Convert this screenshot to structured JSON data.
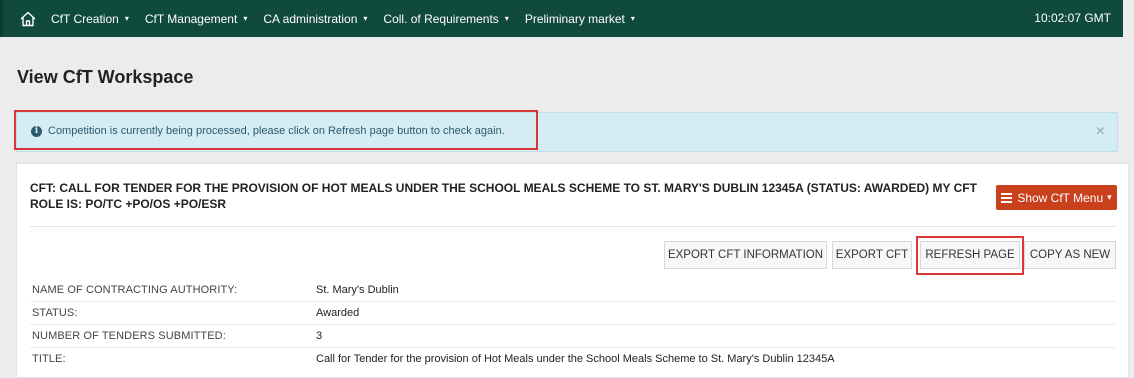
{
  "nav": {
    "items": [
      {
        "label": "CfT Creation"
      },
      {
        "label": "CfT Management"
      },
      {
        "label": "CA administration"
      },
      {
        "label": "Coll. of Requirements"
      },
      {
        "label": "Preliminary market"
      }
    ],
    "clock": "10:02:07 GMT",
    "home_icon": "home-icon"
  },
  "page": {
    "title": "View CfT Workspace"
  },
  "alert": {
    "text": "Competition is currently being processed, please click on Refresh page button to check again.",
    "close": "×",
    "info_icon": "i"
  },
  "cft": {
    "heading": "CFT: CALL FOR TENDER FOR THE PROVISION OF HOT MEALS UNDER THE SCHOOL MEALS SCHEME TO ST. MARY'S DUBLIN 12345A (STATUS: AWARDED) MY CFT ROLE IS: PO/TC +PO/OS +PO/ESR",
    "show_menu_label": "Show CfT Menu",
    "show_menu_caret": "▾"
  },
  "actions": {
    "export_info": "EXPORT CFT INFORMATION",
    "export_cft": "EXPORT CFT",
    "refresh": "REFRESH PAGE",
    "copy_as_new": "COPY AS NEW"
  },
  "details": [
    {
      "label": "NAME OF CONTRACTING AUTHORITY:",
      "value": "St. Mary's Dublin"
    },
    {
      "label": "STATUS:",
      "value": "Awarded"
    },
    {
      "label": "NUMBER OF TENDERS SUBMITTED:",
      "value": "3"
    },
    {
      "label": "TITLE:",
      "value": "Call for Tender for the provision of Hot Meals under the School Meals Scheme to St. Mary's Dublin 12345A"
    }
  ],
  "colors": {
    "nav_bg": "#0f4a3c",
    "alert_bg": "#d4ecf4",
    "menu_button": "#c8401c",
    "highlight": "#d93636"
  }
}
